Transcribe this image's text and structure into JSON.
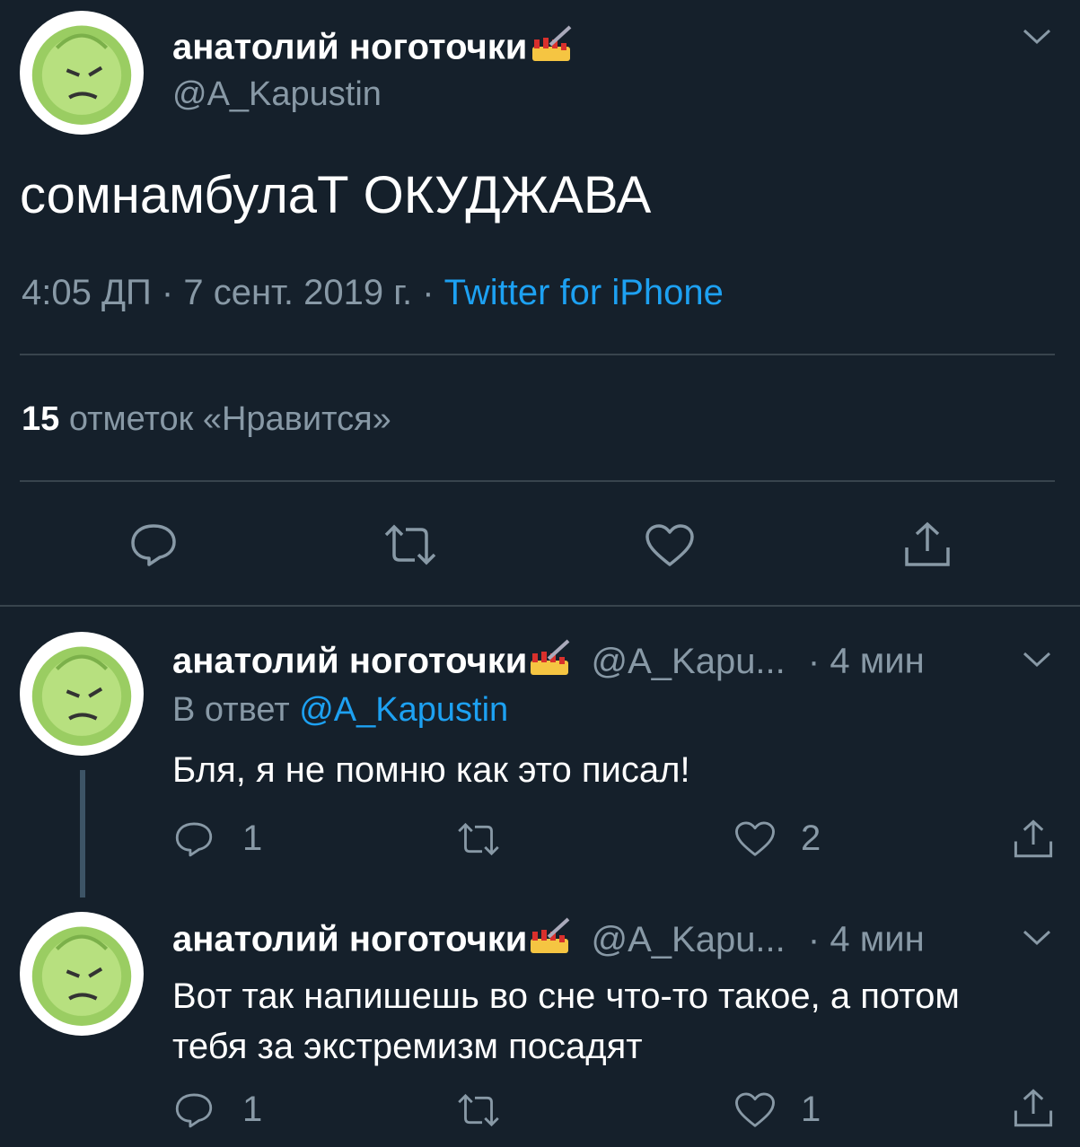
{
  "main_tweet": {
    "author_name": "анатолий ноготочки",
    "name_emoji_icon": "nail-polish-icon",
    "handle": "@A_Kapustin",
    "text": "сомнамбулаТ ОКУДЖАВА",
    "time": "4:05 ДП · 7 сент. 2019 г.",
    "source_sep": "·",
    "source": "Twitter for iPhone",
    "likes_count": "15",
    "likes_label": "отметок «Нравится»",
    "actions": [
      "reply-icon",
      "retweet-icon",
      "like-icon",
      "share-icon"
    ]
  },
  "replies": [
    {
      "author_name": "анатолий ноготочки",
      "handle": "@A_Kapu...",
      "time_sep": "·",
      "time": "4 мин",
      "reply_to_label": "В ответ",
      "reply_to_handle": "@A_Kapustin",
      "text": "Бля, я не помню как это писал!",
      "reply_count": "1",
      "retweet_count": "",
      "like_count": "2"
    },
    {
      "author_name": "анатолий ноготочки",
      "handle": "@A_Kapu...",
      "time_sep": "·",
      "time": "4 мин",
      "text_line1": "Вот так напишешь во сне что-то такое, а потом",
      "text_line2": "тебя за экстремизм посадят",
      "reply_count": "1",
      "retweet_count": "",
      "like_count": "1"
    }
  ],
  "colors": {
    "background": "#15202b",
    "text": "#ffffff",
    "muted": "#8899a6",
    "link": "#1da1f2",
    "divider": "#38444d"
  }
}
